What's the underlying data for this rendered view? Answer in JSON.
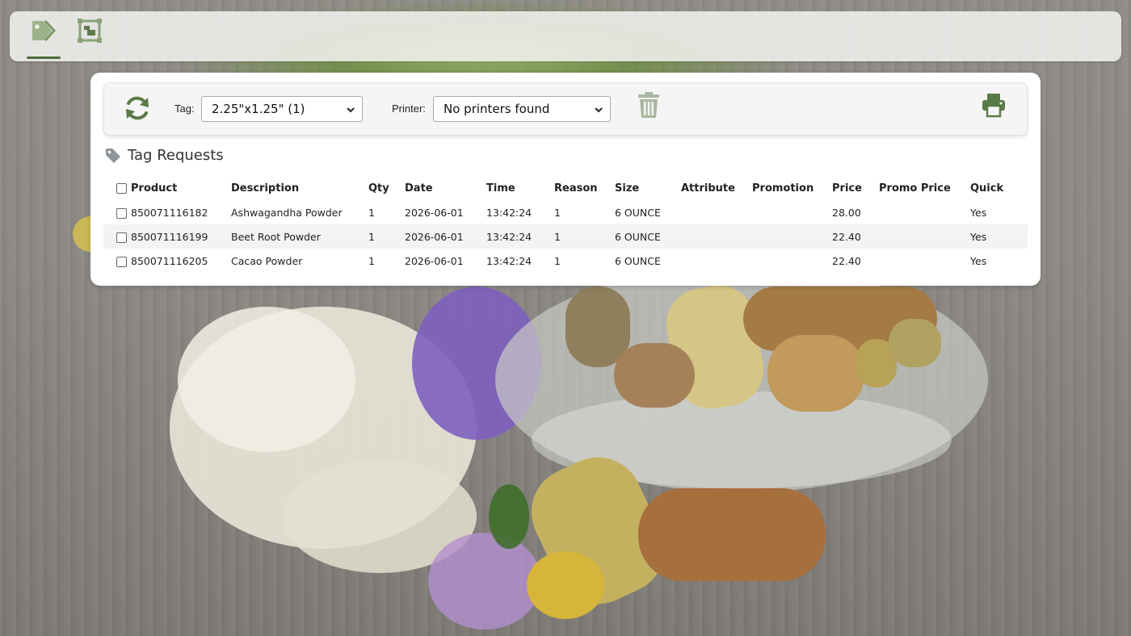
{
  "nav": {
    "tabs": [
      {
        "icon": "tag-icon",
        "active": true
      },
      {
        "icon": "image-frame-icon",
        "active": false
      }
    ],
    "accent_color": "#4e6b3b"
  },
  "toolbar": {
    "refresh_icon": "refresh-icon",
    "tag_label": "Tag:",
    "tag_selected": "2.25\"x1.25\" (1)",
    "printer_label": "Printer:",
    "printer_selected": "No printers found",
    "delete_icon": "trash-icon",
    "print_icon": "printer-icon",
    "icon_color": "#5a7a48"
  },
  "section": {
    "title": "Tag Requests",
    "icon": "tag-icon"
  },
  "table": {
    "columns": [
      "Product",
      "Description",
      "Qty",
      "Date",
      "Time",
      "Reason",
      "Size",
      "Attribute",
      "Promotion",
      "Price",
      "Promo Price",
      "Quick"
    ],
    "rows": [
      {
        "product": "850071116182",
        "description": "Ashwagandha Powder",
        "qty": "1",
        "date": "2026-06-01",
        "time": "13:42:24",
        "reason": "1",
        "size": "6 OUNCE",
        "attribute": "",
        "promotion": "",
        "price": "28.00",
        "promo_price": "",
        "quick": "Yes"
      },
      {
        "product": "850071116199",
        "description": "Beet Root Powder",
        "qty": "1",
        "date": "2026-06-01",
        "time": "13:42:24",
        "reason": "1",
        "size": "6 OUNCE",
        "attribute": "",
        "promotion": "",
        "price": "22.40",
        "promo_price": "",
        "quick": "Yes"
      },
      {
        "product": "850071116205",
        "description": "Cacao Powder",
        "qty": "1",
        "date": "2026-06-01",
        "time": "13:42:24",
        "reason": "1",
        "size": "6 OUNCE",
        "attribute": "",
        "promotion": "",
        "price": "22.40",
        "promo_price": "",
        "quick": "Yes"
      }
    ]
  }
}
